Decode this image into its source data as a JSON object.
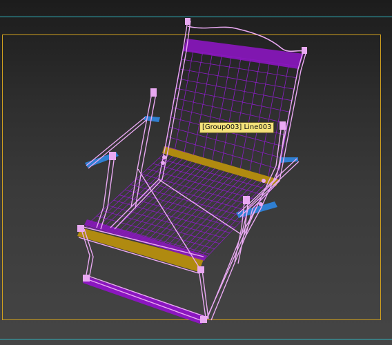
{
  "viewport": {
    "tooltip_text": "[Group003] Line003",
    "colors": {
      "guide_line": "#2fb8c4",
      "safe_frame": "#d1a01e",
      "tooltip_bg": "#f4e27a",
      "tooltip_text": "#101010",
      "wire_frame": "#e9a9f2",
      "wire_mesh": "#8a1ec4",
      "slat_purple": "#8b16c0",
      "slat_gold": "#b08a10",
      "armrest_blue": "#2f7fd2"
    },
    "icons": {
      "chair_model": "chair-wireframe-model"
    }
  }
}
